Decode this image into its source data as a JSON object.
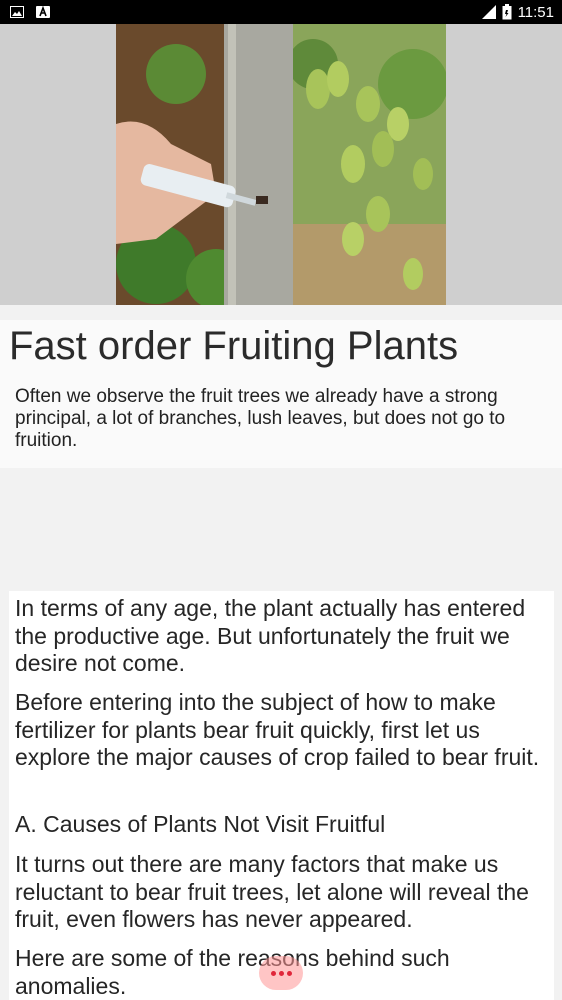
{
  "status_bar": {
    "time": "11:51",
    "icons": [
      "image-icon",
      "a-icon",
      "signal-icon",
      "battery-icon"
    ]
  },
  "article": {
    "title": "Fast order Fruiting Plants",
    "intro": "Often we observe the fruit trees we already have a strong principal, a lot of branches, lush leaves, but does not go to fruition.",
    "paragraphs": [
      " In terms of any age, the plant actually has entered the productive age. But unfortunately the fruit we desire not come.",
      " Before entering into the subject of how to make fertilizer for plants bear fruit quickly, first let us explore the major causes of crop failed to bear fruit.",
      " A. Causes of Plants Not Visit Fruitful",
      " It turns out there are many factors that make us reluctant to bear fruit trees, let alone will reveal the fruit, even flowers has never appeared.",
      " Here are some of the reasons behind such anomalies."
    ]
  },
  "colors": {
    "status_bar_bg": "#000000",
    "page_bg": "#f2f2f2",
    "fab_dots": "#e0263a"
  },
  "fab": {
    "icon": "more-dots-icon"
  }
}
